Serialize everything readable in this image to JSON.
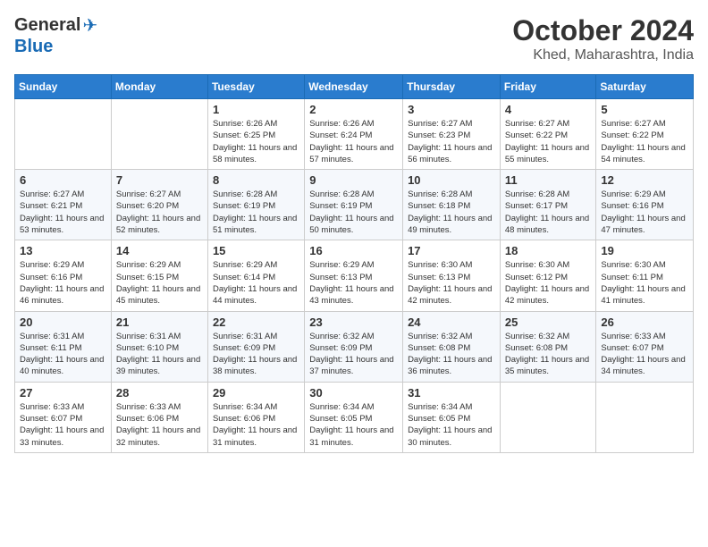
{
  "header": {
    "logo_general": "General",
    "logo_blue": "Blue",
    "month": "October 2024",
    "location": "Khed, Maharashtra, India"
  },
  "weekdays": [
    "Sunday",
    "Monday",
    "Tuesday",
    "Wednesday",
    "Thursday",
    "Friday",
    "Saturday"
  ],
  "weeks": [
    [
      {
        "day": "",
        "sunrise": "",
        "sunset": "",
        "daylight": ""
      },
      {
        "day": "",
        "sunrise": "",
        "sunset": "",
        "daylight": ""
      },
      {
        "day": "1",
        "sunrise": "Sunrise: 6:26 AM",
        "sunset": "Sunset: 6:25 PM",
        "daylight": "Daylight: 11 hours and 58 minutes."
      },
      {
        "day": "2",
        "sunrise": "Sunrise: 6:26 AM",
        "sunset": "Sunset: 6:24 PM",
        "daylight": "Daylight: 11 hours and 57 minutes."
      },
      {
        "day": "3",
        "sunrise": "Sunrise: 6:27 AM",
        "sunset": "Sunset: 6:23 PM",
        "daylight": "Daylight: 11 hours and 56 minutes."
      },
      {
        "day": "4",
        "sunrise": "Sunrise: 6:27 AM",
        "sunset": "Sunset: 6:22 PM",
        "daylight": "Daylight: 11 hours and 55 minutes."
      },
      {
        "day": "5",
        "sunrise": "Sunrise: 6:27 AM",
        "sunset": "Sunset: 6:22 PM",
        "daylight": "Daylight: 11 hours and 54 minutes."
      }
    ],
    [
      {
        "day": "6",
        "sunrise": "Sunrise: 6:27 AM",
        "sunset": "Sunset: 6:21 PM",
        "daylight": "Daylight: 11 hours and 53 minutes."
      },
      {
        "day": "7",
        "sunrise": "Sunrise: 6:27 AM",
        "sunset": "Sunset: 6:20 PM",
        "daylight": "Daylight: 11 hours and 52 minutes."
      },
      {
        "day": "8",
        "sunrise": "Sunrise: 6:28 AM",
        "sunset": "Sunset: 6:19 PM",
        "daylight": "Daylight: 11 hours and 51 minutes."
      },
      {
        "day": "9",
        "sunrise": "Sunrise: 6:28 AM",
        "sunset": "Sunset: 6:19 PM",
        "daylight": "Daylight: 11 hours and 50 minutes."
      },
      {
        "day": "10",
        "sunrise": "Sunrise: 6:28 AM",
        "sunset": "Sunset: 6:18 PM",
        "daylight": "Daylight: 11 hours and 49 minutes."
      },
      {
        "day": "11",
        "sunrise": "Sunrise: 6:28 AM",
        "sunset": "Sunset: 6:17 PM",
        "daylight": "Daylight: 11 hours and 48 minutes."
      },
      {
        "day": "12",
        "sunrise": "Sunrise: 6:29 AM",
        "sunset": "Sunset: 6:16 PM",
        "daylight": "Daylight: 11 hours and 47 minutes."
      }
    ],
    [
      {
        "day": "13",
        "sunrise": "Sunrise: 6:29 AM",
        "sunset": "Sunset: 6:16 PM",
        "daylight": "Daylight: 11 hours and 46 minutes."
      },
      {
        "day": "14",
        "sunrise": "Sunrise: 6:29 AM",
        "sunset": "Sunset: 6:15 PM",
        "daylight": "Daylight: 11 hours and 45 minutes."
      },
      {
        "day": "15",
        "sunrise": "Sunrise: 6:29 AM",
        "sunset": "Sunset: 6:14 PM",
        "daylight": "Daylight: 11 hours and 44 minutes."
      },
      {
        "day": "16",
        "sunrise": "Sunrise: 6:29 AM",
        "sunset": "Sunset: 6:13 PM",
        "daylight": "Daylight: 11 hours and 43 minutes."
      },
      {
        "day": "17",
        "sunrise": "Sunrise: 6:30 AM",
        "sunset": "Sunset: 6:13 PM",
        "daylight": "Daylight: 11 hours and 42 minutes."
      },
      {
        "day": "18",
        "sunrise": "Sunrise: 6:30 AM",
        "sunset": "Sunset: 6:12 PM",
        "daylight": "Daylight: 11 hours and 42 minutes."
      },
      {
        "day": "19",
        "sunrise": "Sunrise: 6:30 AM",
        "sunset": "Sunset: 6:11 PM",
        "daylight": "Daylight: 11 hours and 41 minutes."
      }
    ],
    [
      {
        "day": "20",
        "sunrise": "Sunrise: 6:31 AM",
        "sunset": "Sunset: 6:11 PM",
        "daylight": "Daylight: 11 hours and 40 minutes."
      },
      {
        "day": "21",
        "sunrise": "Sunrise: 6:31 AM",
        "sunset": "Sunset: 6:10 PM",
        "daylight": "Daylight: 11 hours and 39 minutes."
      },
      {
        "day": "22",
        "sunrise": "Sunrise: 6:31 AM",
        "sunset": "Sunset: 6:09 PM",
        "daylight": "Daylight: 11 hours and 38 minutes."
      },
      {
        "day": "23",
        "sunrise": "Sunrise: 6:32 AM",
        "sunset": "Sunset: 6:09 PM",
        "daylight": "Daylight: 11 hours and 37 minutes."
      },
      {
        "day": "24",
        "sunrise": "Sunrise: 6:32 AM",
        "sunset": "Sunset: 6:08 PM",
        "daylight": "Daylight: 11 hours and 36 minutes."
      },
      {
        "day": "25",
        "sunrise": "Sunrise: 6:32 AM",
        "sunset": "Sunset: 6:08 PM",
        "daylight": "Daylight: 11 hours and 35 minutes."
      },
      {
        "day": "26",
        "sunrise": "Sunrise: 6:33 AM",
        "sunset": "Sunset: 6:07 PM",
        "daylight": "Daylight: 11 hours and 34 minutes."
      }
    ],
    [
      {
        "day": "27",
        "sunrise": "Sunrise: 6:33 AM",
        "sunset": "Sunset: 6:07 PM",
        "daylight": "Daylight: 11 hours and 33 minutes."
      },
      {
        "day": "28",
        "sunrise": "Sunrise: 6:33 AM",
        "sunset": "Sunset: 6:06 PM",
        "daylight": "Daylight: 11 hours and 32 minutes."
      },
      {
        "day": "29",
        "sunrise": "Sunrise: 6:34 AM",
        "sunset": "Sunset: 6:06 PM",
        "daylight": "Daylight: 11 hours and 31 minutes."
      },
      {
        "day": "30",
        "sunrise": "Sunrise: 6:34 AM",
        "sunset": "Sunset: 6:05 PM",
        "daylight": "Daylight: 11 hours and 31 minutes."
      },
      {
        "day": "31",
        "sunrise": "Sunrise: 6:34 AM",
        "sunset": "Sunset: 6:05 PM",
        "daylight": "Daylight: 11 hours and 30 minutes."
      },
      {
        "day": "",
        "sunrise": "",
        "sunset": "",
        "daylight": ""
      },
      {
        "day": "",
        "sunrise": "",
        "sunset": "",
        "daylight": ""
      }
    ]
  ]
}
